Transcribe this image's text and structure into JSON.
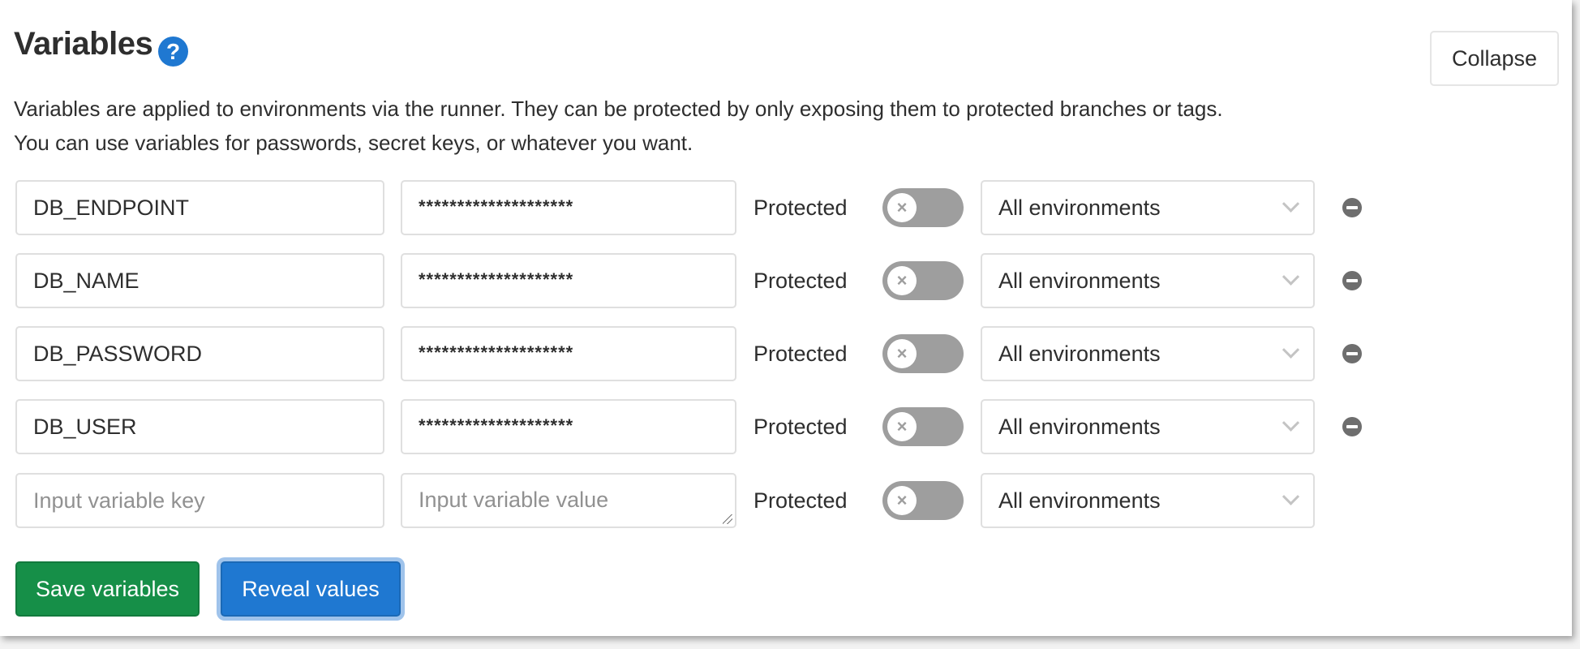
{
  "section": {
    "title": "Variables",
    "help_icon": "question-circle-icon",
    "description_line1": "Variables are applied to environments via the runner. They can be protected by only exposing them to protected branches or tags.",
    "description_line2": "You can use variables for passwords, secret keys, or whatever you want.",
    "collapse_label": "Collapse"
  },
  "variables": [
    {
      "key": "DB_ENDPOINT",
      "value": "********************",
      "protected_label": "Protected",
      "protected": false,
      "environment": "All environments"
    },
    {
      "key": "DB_NAME",
      "value": "********************",
      "protected_label": "Protected",
      "protected": false,
      "environment": "All environments"
    },
    {
      "key": "DB_PASSWORD",
      "value": "********************",
      "protected_label": "Protected",
      "protected": false,
      "environment": "All environments"
    },
    {
      "key": "DB_USER",
      "value": "********************",
      "protected_label": "Protected",
      "protected": false,
      "environment": "All environments"
    }
  ],
  "new_variable": {
    "key_placeholder": "Input variable key",
    "value_placeholder": "Input variable value",
    "protected_label": "Protected",
    "protected": false,
    "environment": "All environments"
  },
  "actions": {
    "save_label": "Save variables",
    "reveal_label": "Reveal values"
  },
  "colors": {
    "primary_blue": "#1f78d1",
    "success_green": "#168f48",
    "toggle_off": "#9e9e9e"
  }
}
